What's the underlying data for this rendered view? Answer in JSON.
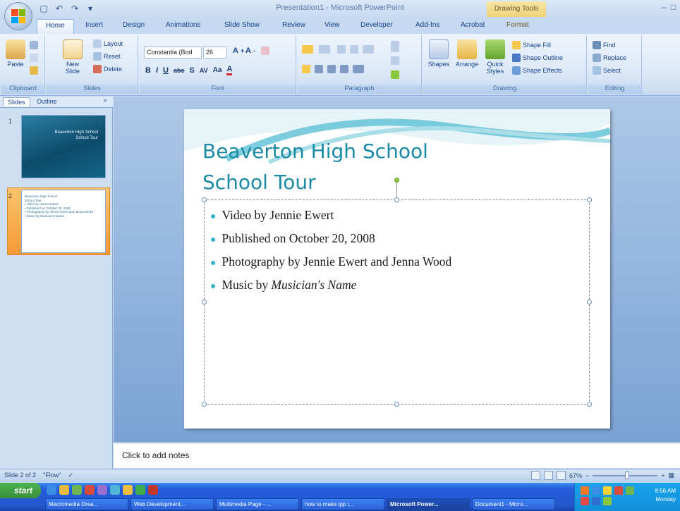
{
  "window": {
    "title": "Presentation1 - Microsoft PowerPoint",
    "contextual_tab_group": "Drawing Tools"
  },
  "tabs": [
    "Home",
    "Insert",
    "Design",
    "Animations",
    "Slide Show",
    "Review",
    "View",
    "Developer",
    "Add-Ins",
    "Acrobat",
    "Format"
  ],
  "ribbon": {
    "clipboard": {
      "label": "Clipboard",
      "paste": "Paste"
    },
    "slides": {
      "label": "Slides",
      "new_slide": "New Slide",
      "layout": "Layout",
      "reset": "Reset",
      "delete": "Delete"
    },
    "font": {
      "label": "Font",
      "font_name": "Constantia (Bod",
      "font_size": "26",
      "bold": "B",
      "italic": "I",
      "underline": "U",
      "strike": "abc",
      "shadow": "S",
      "spacing": "AV",
      "case": "Aa",
      "color": "A"
    },
    "paragraph": {
      "label": "Paragraph"
    },
    "drawing": {
      "label": "Drawing",
      "shapes": "Shapes",
      "arrange": "Arrange",
      "quick_styles": "Quick Styles",
      "shape_fill": "Shape Fill",
      "shape_outline": "Shape Outline",
      "shape_effects": "Shape Effects"
    },
    "editing": {
      "label": "Editing",
      "find": "Find",
      "replace": "Replace",
      "select": "Select"
    }
  },
  "panel": {
    "tabs": [
      "Slides",
      "Outline"
    ],
    "thumb1": {
      "number": "1",
      "line1": "Beaverton High School",
      "line2": "School Tour"
    },
    "thumb2": {
      "number": "2",
      "lines": [
        "Beaverton High School",
        "School Tour",
        "• Video by Jennie Ewert",
        "• Published on October 20, 2008",
        "• Photography by Jennie Ewert and Jenna Wood",
        "• Music by Musician's Name"
      ]
    }
  },
  "slide": {
    "title_line1": "Beaverton High School",
    "title_line2": "School Tour",
    "bullets": [
      {
        "text": "Video by Jennie Ewert"
      },
      {
        "text": "Published on October 20, 2008"
      },
      {
        "text": "Photography by Jennie Ewert and Jenna Wood"
      },
      {
        "text": "Music by ",
        "italic": "Musician's Name"
      }
    ]
  },
  "notes": {
    "placeholder": "Click to add notes"
  },
  "status": {
    "slide_info": "Slide 2 of 2",
    "theme": "\"Flow\"",
    "zoom": "67%"
  },
  "taskbar": {
    "start": "start",
    "tasks": [
      "Macromedia Drea...",
      "Web Development...",
      "Multimedia Page - ...",
      "how to make ipp i...",
      "Microsoft Power...",
      "Document1 - Micro..."
    ],
    "active_task_index": 4,
    "clock_time": "8:56 AM",
    "clock_day": "Monday"
  },
  "colors": {
    "accent": "#1b8aa4",
    "bullet": "#3ab0c8",
    "ribbon_text": "#15428b"
  }
}
